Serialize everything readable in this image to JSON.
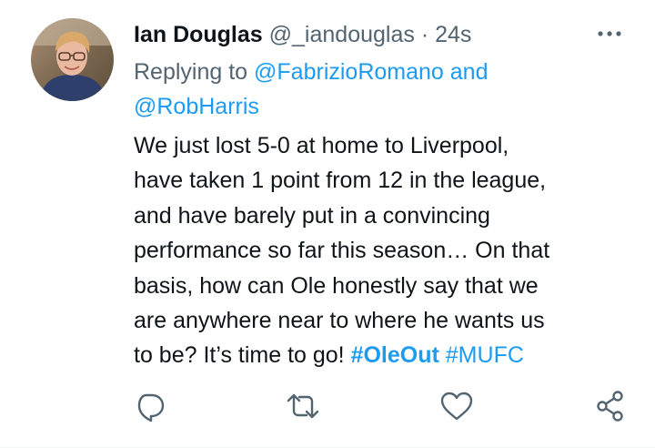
{
  "tweet": {
    "display_name": "Ian Douglas",
    "handle": "@_iandouglas",
    "separator": "·",
    "time": "24s",
    "replying_to": {
      "prefix": "Replying to",
      "user1": "@FabrizioRomano",
      "connector": "and",
      "user2": "@RobHarris"
    },
    "body_lines": [
      "We just lost 5-0 at home to Liverpool,",
      "have taken 1 point from 12 in the league,",
      "and have barely put in a convincing",
      "performance so far this season… On that",
      "basis, how can Ole honestly say that we",
      "are anywhere near to where he wants us"
    ],
    "last_line_text": "to be? It’s time to go!",
    "hashtags": [
      "#OleOut",
      "#MUFC"
    ],
    "actions": {
      "reply_icon": "reply-icon",
      "retweet_icon": "retweet-icon",
      "like_icon": "heart-icon",
      "share_icon": "share-icon"
    },
    "colors": {
      "link": "#1d9bf0",
      "secondary_text": "#536471",
      "primary_text": "#0f1419"
    }
  }
}
